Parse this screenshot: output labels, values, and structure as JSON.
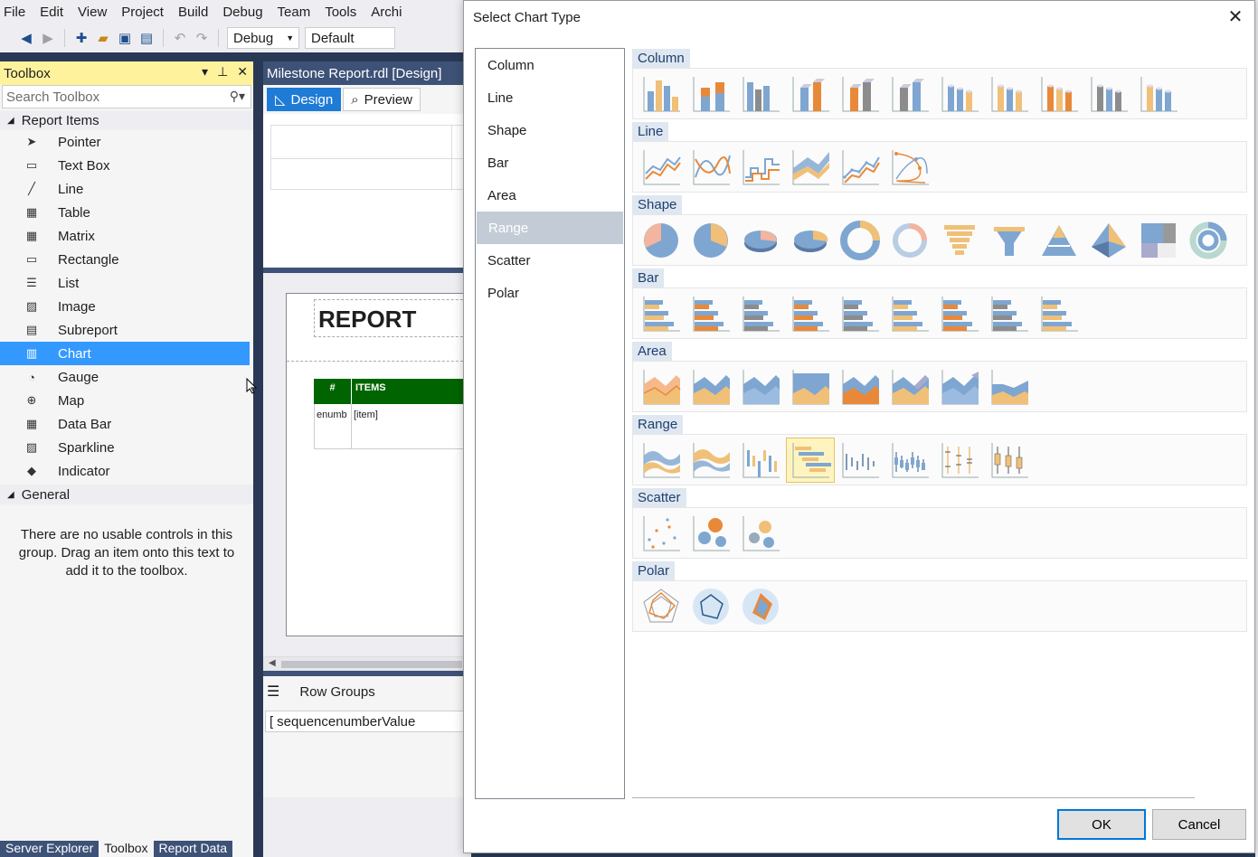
{
  "ide": {
    "menu": [
      "File",
      "Edit",
      "View",
      "Project",
      "Build",
      "Debug",
      "Team",
      "Tools",
      "Archi"
    ],
    "toolbar": {
      "config": "Debug",
      "platform": "Default"
    },
    "toolbox": {
      "title": "Toolbox",
      "search_placeholder": "Search Toolbox",
      "group_report_items": "Report Items",
      "items": [
        {
          "label": "Pointer",
          "icon": "pointer-icon"
        },
        {
          "label": "Text Box",
          "icon": "textbox-icon"
        },
        {
          "label": "Line",
          "icon": "line-icon"
        },
        {
          "label": "Table",
          "icon": "table-icon"
        },
        {
          "label": "Matrix",
          "icon": "matrix-icon"
        },
        {
          "label": "Rectangle",
          "icon": "rectangle-icon"
        },
        {
          "label": "List",
          "icon": "list-icon"
        },
        {
          "label": "Image",
          "icon": "image-icon"
        },
        {
          "label": "Subreport",
          "icon": "subreport-icon"
        },
        {
          "label": "Chart",
          "icon": "chart-icon",
          "selected": true
        },
        {
          "label": "Gauge",
          "icon": "gauge-icon"
        },
        {
          "label": "Map",
          "icon": "map-icon"
        },
        {
          "label": "Data Bar",
          "icon": "databar-icon"
        },
        {
          "label": "Sparkline",
          "icon": "sparkline-icon"
        },
        {
          "label": "Indicator",
          "icon": "indicator-icon"
        }
      ],
      "group_general": "General",
      "general_message": "There are no usable controls in this group. Drag an item onto this text to add it to the toolbox."
    },
    "bottom_tabs": [
      "Server Explorer",
      "Toolbox",
      "Report Data"
    ],
    "editor": {
      "title": "Milestone Report.rdl [Design]",
      "tab_design": "Design",
      "tab_preview": "Preview",
      "report_title": "REPORT",
      "table_headers": [
        "#",
        "ITEMS"
      ],
      "table_cells": [
        "enumb",
        "[item]"
      ],
      "row_groups_label": "Row Groups",
      "row_group_item": "sequencenumberValue"
    }
  },
  "dialog": {
    "title": "Select Chart Type",
    "categories": [
      "Column",
      "Line",
      "Shape",
      "Bar",
      "Area",
      "Range",
      "Scatter",
      "Polar"
    ],
    "selected_category": "Range",
    "sections": {
      "column": "Column",
      "line": "Line",
      "shape": "Shape",
      "bar": "Bar",
      "area": "Area",
      "range": "Range",
      "scatter": "Scatter",
      "polar": "Polar"
    },
    "ok_label": "OK",
    "cancel_label": "Cancel",
    "colors": {
      "blue": "#7ea6d1",
      "orange": "#e8893a",
      "tan": "#f0c078",
      "gray": "#8c8c8c",
      "accent": "#0078d7"
    }
  }
}
